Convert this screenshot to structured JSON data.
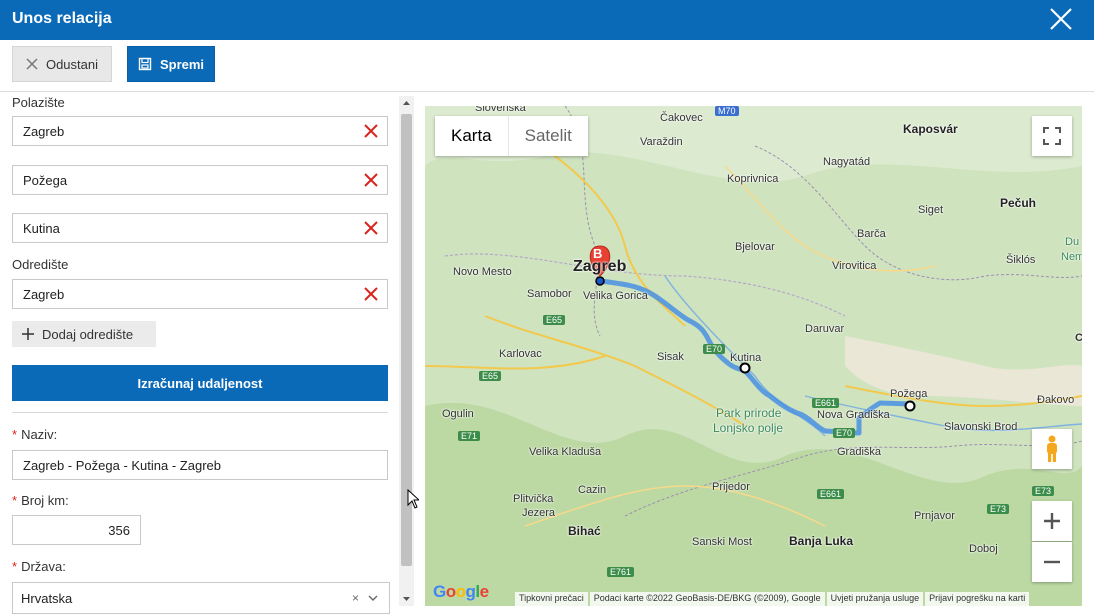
{
  "window": {
    "title": "Unos relacija"
  },
  "toolbar": {
    "cancel_label": "Odustani",
    "save_label": "Spremi"
  },
  "form": {
    "origin_label": "Polazište",
    "stops": [
      "Zagreb",
      "Požega",
      "Kutina"
    ],
    "destination_label": "Odredište",
    "destination": "Zagreb",
    "add_destination_label": "Dodaj odredište",
    "calculate_label": "Izračunaj udaljenost",
    "name_label": "Naziv:",
    "name_value": "Zagreb - Požega - Kutina - Zagreb",
    "km_label": "Broj km:",
    "km_value": "356",
    "country_label": "Država:",
    "country_value": "Hrvatska",
    "country_clear": "×"
  },
  "map": {
    "type_map": "Karta",
    "type_satellite": "Satelit",
    "marker_label": "B",
    "logo": "Google",
    "attribution": [
      "Tipkovni prečaci",
      "Podaci karte ©2022 GeoBasis-DE/BKG (©2009), Google",
      "Uvjeti pružanja usluge",
      "Prijavi pogrešku na karti"
    ],
    "places": {
      "slovenska": "Slovenska",
      "cakovec": "Čakovec",
      "varazdin": "Varaždin",
      "kaposvar": "Kaposvár",
      "nagyatad": "Nagyatád",
      "koprivnica": "Koprivnica",
      "siget": "Siget",
      "pecuh": "Pečuh",
      "barca": "Barča",
      "bjelovar": "Bjelovar",
      "virovitica": "Virovitica",
      "siklos": "Šiklós",
      "novo_mesto": "Novo Mesto",
      "zagreb": "Zagreb",
      "samobor": "Samobor",
      "velika_gorica": "Velika Gorica",
      "daruvar": "Daruvar",
      "karlovac": "Karlovac",
      "sisak": "Sisak",
      "kutina": "Kutina",
      "pozega": "Požega",
      "ogulin": "Ogulin",
      "park1": "Park prirode",
      "park2": "Lonjsko polje",
      "nova_gradiska": "Nova Gradiška",
      "djakovo": "Đakovo",
      "slavonski_brod": "Slavonski Brod",
      "gradiska": "Gradiška",
      "velika_kladusa": "Velika Kladuša",
      "prijedor": "Prijedor",
      "plitvicka": "Plitvička",
      "jezera": "Jezera",
      "cazin": "Cazin",
      "bihac": "Bihać",
      "prnjavor": "Prnjavor",
      "sanski_most": "Sanski Most",
      "banja_luka": "Banja Luka",
      "doboj": "Doboj",
      "duz": "Du",
      "nem": "Nem",
      "c_edge": "C"
    },
    "roads": [
      "M70",
      "E65",
      "E65",
      "E70",
      "E661",
      "E70",
      "E71",
      "E661",
      "E73",
      "E73",
      "E761"
    ]
  }
}
